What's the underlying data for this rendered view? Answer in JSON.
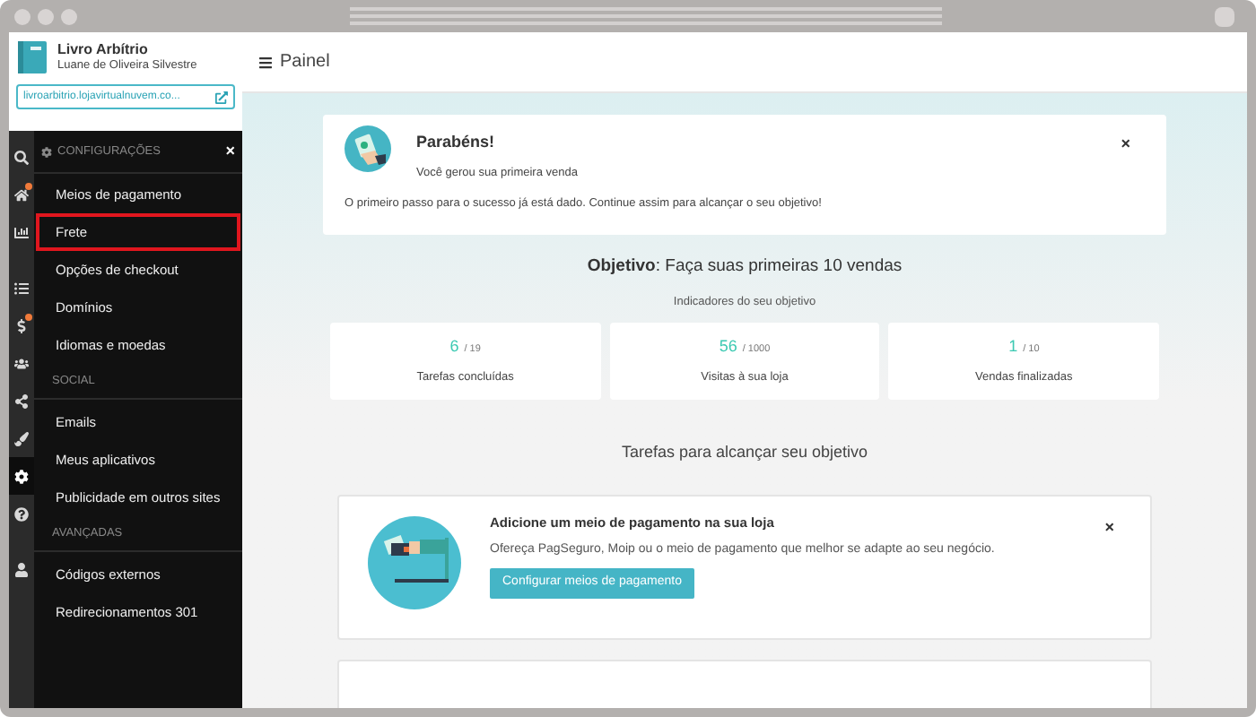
{
  "store": {
    "title": "Livro Arbítrio",
    "owner": "Luane de Oliveira Silvestre",
    "link": "livroarbitrio.lojavirtualnuvem.co..."
  },
  "rail": [
    [
      {
        "kind": "search",
        "selected": false,
        "badge": false
      },
      {
        "kind": "home",
        "selected": false,
        "badge": true
      },
      {
        "kind": "chart",
        "selected": false,
        "badge": false
      }
    ],
    [
      {
        "kind": "list",
        "selected": false,
        "badge": false
      },
      {
        "kind": "dollar",
        "selected": false,
        "badge": true
      },
      {
        "kind": "users",
        "selected": false,
        "badge": false
      },
      {
        "kind": "share",
        "selected": false,
        "badge": false
      },
      {
        "kind": "brush",
        "selected": false,
        "badge": false
      },
      {
        "kind": "gear",
        "selected": true,
        "badge": false
      },
      {
        "kind": "help",
        "selected": false,
        "badge": false
      }
    ],
    [
      {
        "kind": "user",
        "selected": false,
        "badge": false
      }
    ]
  ],
  "menu": {
    "title": "CONFIGURAÇÕES",
    "close": "×",
    "sections": [
      {
        "items": [
          {
            "label": "Meios de pagamento",
            "selected": false
          },
          {
            "label": "Frete",
            "selected": true
          },
          {
            "label": "Opções de checkout",
            "selected": false
          },
          {
            "label": "Domínios",
            "selected": false
          },
          {
            "label": "Idiomas e moedas",
            "selected": false
          }
        ]
      },
      {
        "heading": "SOCIAL",
        "items": [
          {
            "label": "Emails",
            "selected": false
          },
          {
            "label": "Meus aplicativos",
            "selected": false
          },
          {
            "label": "Publicidade em outros sites",
            "selected": false
          }
        ]
      },
      {
        "heading": "AVANÇADAS",
        "items": [
          {
            "label": "Códigos externos",
            "selected": false
          },
          {
            "label": "Redirecionamentos 301",
            "selected": false
          }
        ]
      }
    ]
  },
  "header": {
    "title": "Painel"
  },
  "congrats": {
    "title": "Parabéns!",
    "subtitle": "Você gerou sua primeira venda",
    "message": "O primeiro passo para o sucesso já está dado. Continue assim para alcançar o seu objetivo!",
    "close": "×"
  },
  "objective": "**Objetivo**: Faça suas primeiras 10 vendas",
  "indicators_title": "Indicadores do seu objetivo",
  "indicators": [
    {
      "value": "6",
      "total": "/ 19",
      "label": "Tarefas concluídas"
    },
    {
      "value": "56",
      "total": "/ 1000",
      "label": "Visitas à sua loja"
    },
    {
      "value": "1",
      "total": "/ 10",
      "label": "Vendas finalizadas"
    }
  ],
  "tasks_title": "Tarefas para alcançar seu objetivo",
  "tasks": [
    {
      "title": "Adicione um meio de pagamento na sua loja",
      "description": "Ofereça PagSeguro, Moip ou o meio de pagamento que melhor se adapte ao seu negócio.",
      "button": "Configurar meios de pagamento",
      "close": "×"
    }
  ]
}
